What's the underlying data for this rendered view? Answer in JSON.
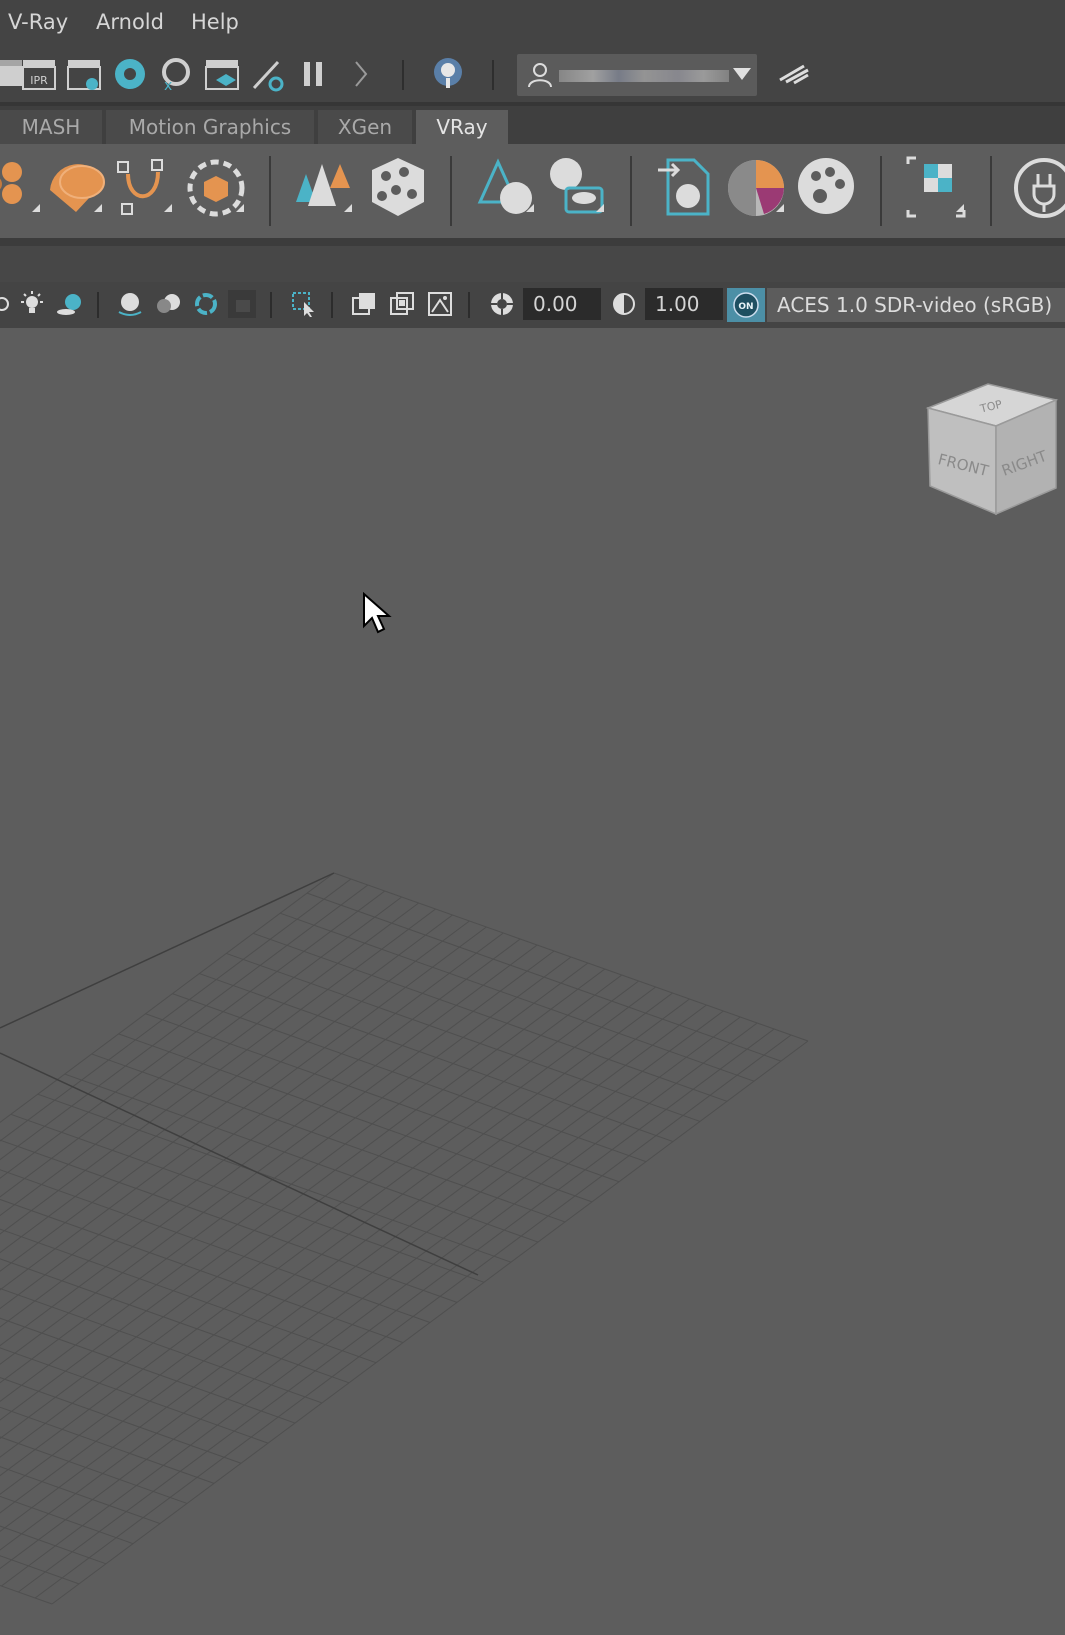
{
  "menubar": {
    "items": [
      "V-Ray",
      "Arnold",
      "Help"
    ]
  },
  "shelf_tabs": {
    "items": [
      "MASH",
      "Motion Graphics",
      "XGen",
      "VRay"
    ],
    "active": "VRay"
  },
  "viewport_toolbar": {
    "exposure_value": "0.00",
    "gamma_value": "1.00",
    "color_mgmt_badge": "ON",
    "color_space": "ACES 1.0 SDR-video (sRGB)"
  },
  "viewcube": {
    "top": "TOP",
    "front": "FRONT",
    "right": "RIGHT"
  },
  "colors": {
    "accent": "#4bb3c7",
    "orange": "#e49450",
    "panel": "#444444",
    "viewport": "#5d5d5d"
  }
}
